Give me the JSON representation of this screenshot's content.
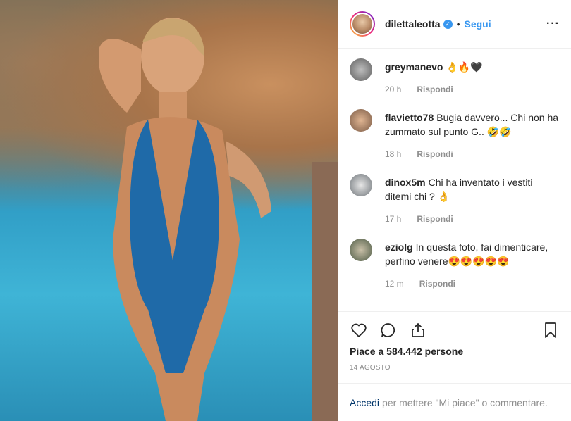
{
  "header": {
    "username": "dilettaleotta",
    "verified_icon": "verified-badge-icon",
    "separator": "•",
    "follow_label": "Segui",
    "more_label": "···"
  },
  "comments": [
    {
      "user": "greymanevo",
      "text": "👌🔥🖤",
      "time": "20 h",
      "reply": "Rispondi",
      "avatar_color": "#7a7a7a"
    },
    {
      "user": "flavietto78",
      "text": "Bugia davvero... Chi non ha zummato sul punto G.. 🤣🤣",
      "time": "18 h",
      "reply": "Rispondi",
      "avatar_color": "#b08a6a"
    },
    {
      "user": "dinox5m",
      "text": "Chi ha inventato i vestiti ditemi chi ? 👌",
      "time": "17 h",
      "reply": "Rispondi",
      "avatar_color": "#9aa0a6"
    },
    {
      "user": "eziolg",
      "text": "In questa foto, fai dimenticare, perfino venere😍😍😍😍😍",
      "time": "12 m",
      "reply": "Rispondi",
      "avatar_color": "#6f7f64"
    }
  ],
  "actions": {
    "like_icon": "heart-icon",
    "comment_icon": "comment-icon",
    "share_icon": "share-icon",
    "save_icon": "bookmark-icon"
  },
  "likes_text": "Piace a 584.442 persone",
  "date_text": "14 AGOSTO",
  "footer": {
    "login_label": "Accedi",
    "rest_text": "per mettere \"Mi piace\" o commentare."
  }
}
